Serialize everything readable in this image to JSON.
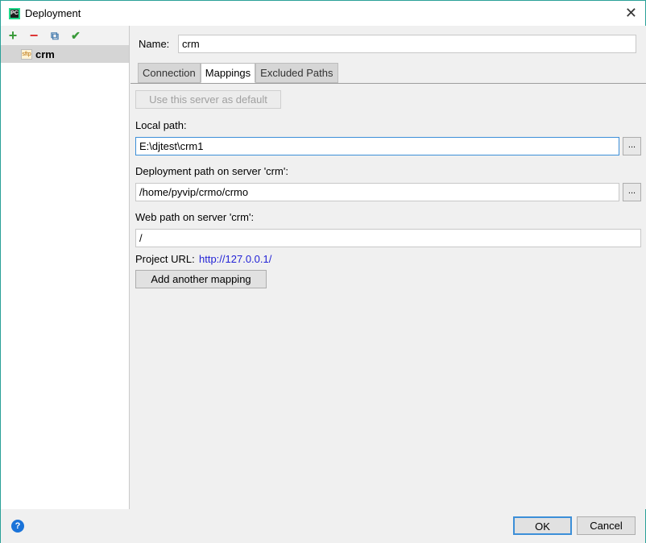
{
  "window": {
    "title": "Deployment",
    "app_icon": "PC"
  },
  "sidebar": {
    "toolbar": {
      "add": "+",
      "remove": "−",
      "copy": "⧉",
      "check": "✔"
    },
    "items": [
      {
        "label": "crm",
        "badge": "sftp"
      }
    ]
  },
  "form": {
    "name_label": "Name:",
    "name_value": "crm",
    "tabs": [
      {
        "label": "Connection"
      },
      {
        "label": "Mappings",
        "active": true
      },
      {
        "label": "Excluded Paths"
      }
    ],
    "use_default_label": "Use this server as default",
    "local_path_label": "Local path:",
    "local_path_value": "E:\\djtest\\crm1",
    "deploy_path_label": "Deployment path on server 'crm':",
    "deploy_path_value": "/home/pyvip/crmo/crmo",
    "web_path_label": "Web path on server 'crm':",
    "web_path_value": "/",
    "project_url_label": "Project URL:",
    "project_url_value": "http://127.0.0.1/",
    "add_mapping_label": "Add another mapping",
    "browse": "..."
  },
  "footer": {
    "help": "?",
    "ok": "OK",
    "cancel": "Cancel"
  }
}
